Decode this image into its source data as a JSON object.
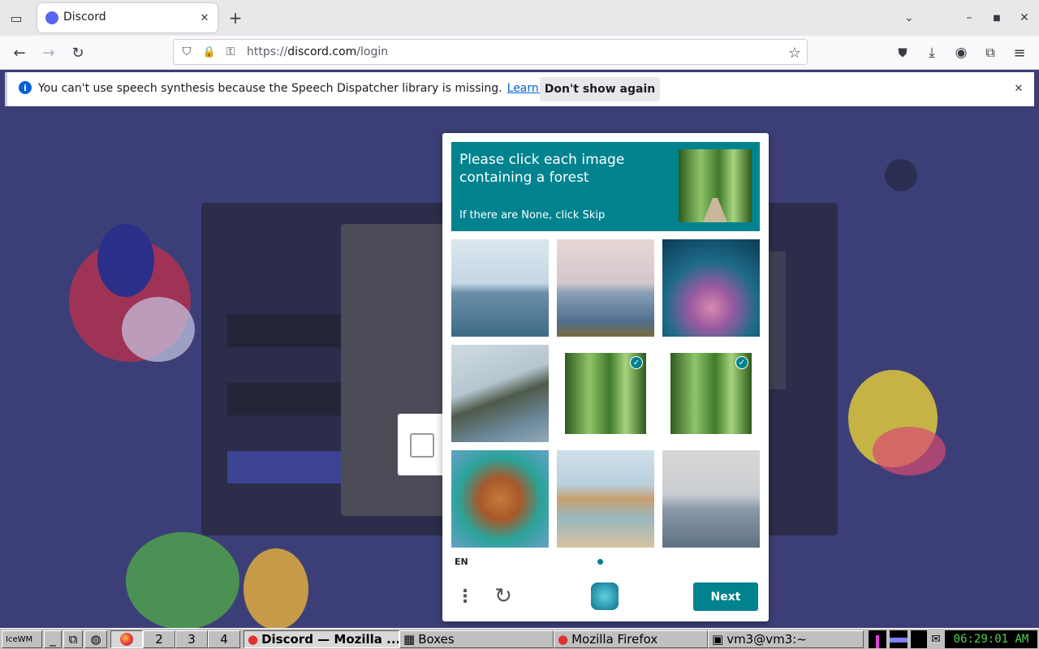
{
  "browser": {
    "tab_title": "Discord",
    "url_prefix": "https://",
    "url_domain": "discord.com",
    "url_path": "/login"
  },
  "notification": {
    "message": "You can't use speech synthesis because the Speech Dispatcher library is missing.",
    "link": "Learn more",
    "button": "Don't show again"
  },
  "captcha": {
    "prompt": "Please click each image containing a forest",
    "hint": "If there are None, click Skip",
    "language": "EN",
    "next_label": "Next",
    "tiles": [
      {
        "subject": "sea with boat",
        "selected": false
      },
      {
        "subject": "cruise ship",
        "selected": false
      },
      {
        "subject": "coral reef",
        "selected": false
      },
      {
        "subject": "coastal cliff",
        "selected": false
      },
      {
        "subject": "bamboo forest",
        "selected": true
      },
      {
        "subject": "bamboo forest",
        "selected": true
      },
      {
        "subject": "rock pool",
        "selected": false
      },
      {
        "subject": "desert stream",
        "selected": false
      },
      {
        "subject": "beach",
        "selected": false
      }
    ]
  },
  "taskbar": {
    "workspaces": [
      "2",
      "3",
      "4"
    ],
    "windows": [
      "Discord — Mozilla ...",
      "Boxes",
      "Mozilla Firefox",
      "vm3@vm3:~"
    ],
    "clock": "06:29:01 AM"
  },
  "colors": {
    "accent": "#00838f",
    "discord": "#5865f2",
    "backdrop": "#3c3f77"
  }
}
